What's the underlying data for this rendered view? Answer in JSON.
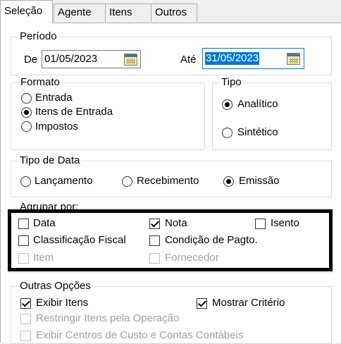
{
  "tabs": [
    {
      "label": "Seleção",
      "active": true
    },
    {
      "label": "Agente",
      "active": false
    },
    {
      "label": "Itens",
      "active": false
    },
    {
      "label": "Outros",
      "active": false
    }
  ],
  "periodo": {
    "title": "Período",
    "de_label": "De",
    "de_value": "01/05/2023",
    "ate_label": "Até",
    "ate_value": "31/05/2023"
  },
  "formato": {
    "title": "Formato",
    "options": [
      {
        "label": "Entrada",
        "selected": false
      },
      {
        "label": "Itens de Entrada",
        "selected": true
      },
      {
        "label": "Impostos",
        "selected": false
      }
    ]
  },
  "tipo": {
    "title": "Tipo",
    "options": [
      {
        "label": "Analítico",
        "selected": true
      },
      {
        "label": "Sintético",
        "selected": false
      }
    ]
  },
  "tipo_data": {
    "title": "Tipo de Data",
    "options": [
      {
        "label": "Lançamento",
        "selected": false
      },
      {
        "label": "Recebimento",
        "selected": false
      },
      {
        "label": "Emissão",
        "selected": true
      }
    ]
  },
  "agrupar": {
    "title": "Agrupar por:",
    "options": [
      {
        "label": "Data",
        "checked": false,
        "enabled": true
      },
      {
        "label": "Nota",
        "checked": true,
        "enabled": true
      },
      {
        "label": "Isento",
        "checked": false,
        "enabled": true
      },
      {
        "label": "Classificação Fiscal",
        "checked": false,
        "enabled": true
      },
      {
        "label": "Condição de Pagto.",
        "checked": false,
        "enabled": true
      },
      {
        "label": "Item",
        "checked": false,
        "enabled": false
      },
      {
        "label": "Fornecedor",
        "checked": false,
        "enabled": false
      }
    ]
  },
  "outras": {
    "title": "Outras Opções",
    "options": [
      {
        "label": "Exibir Itens",
        "checked": true,
        "enabled": true
      },
      {
        "label": "Mostrar Critério",
        "checked": true,
        "enabled": true
      },
      {
        "label": "Restringir Itens pela Operação",
        "checked": false,
        "enabled": false
      },
      {
        "label": "Exibir Centros de Custo e Contas Contábeis",
        "checked": false,
        "enabled": false
      }
    ]
  },
  "colors": {
    "selection": "#0078d7",
    "highlight_border": "#000000"
  }
}
